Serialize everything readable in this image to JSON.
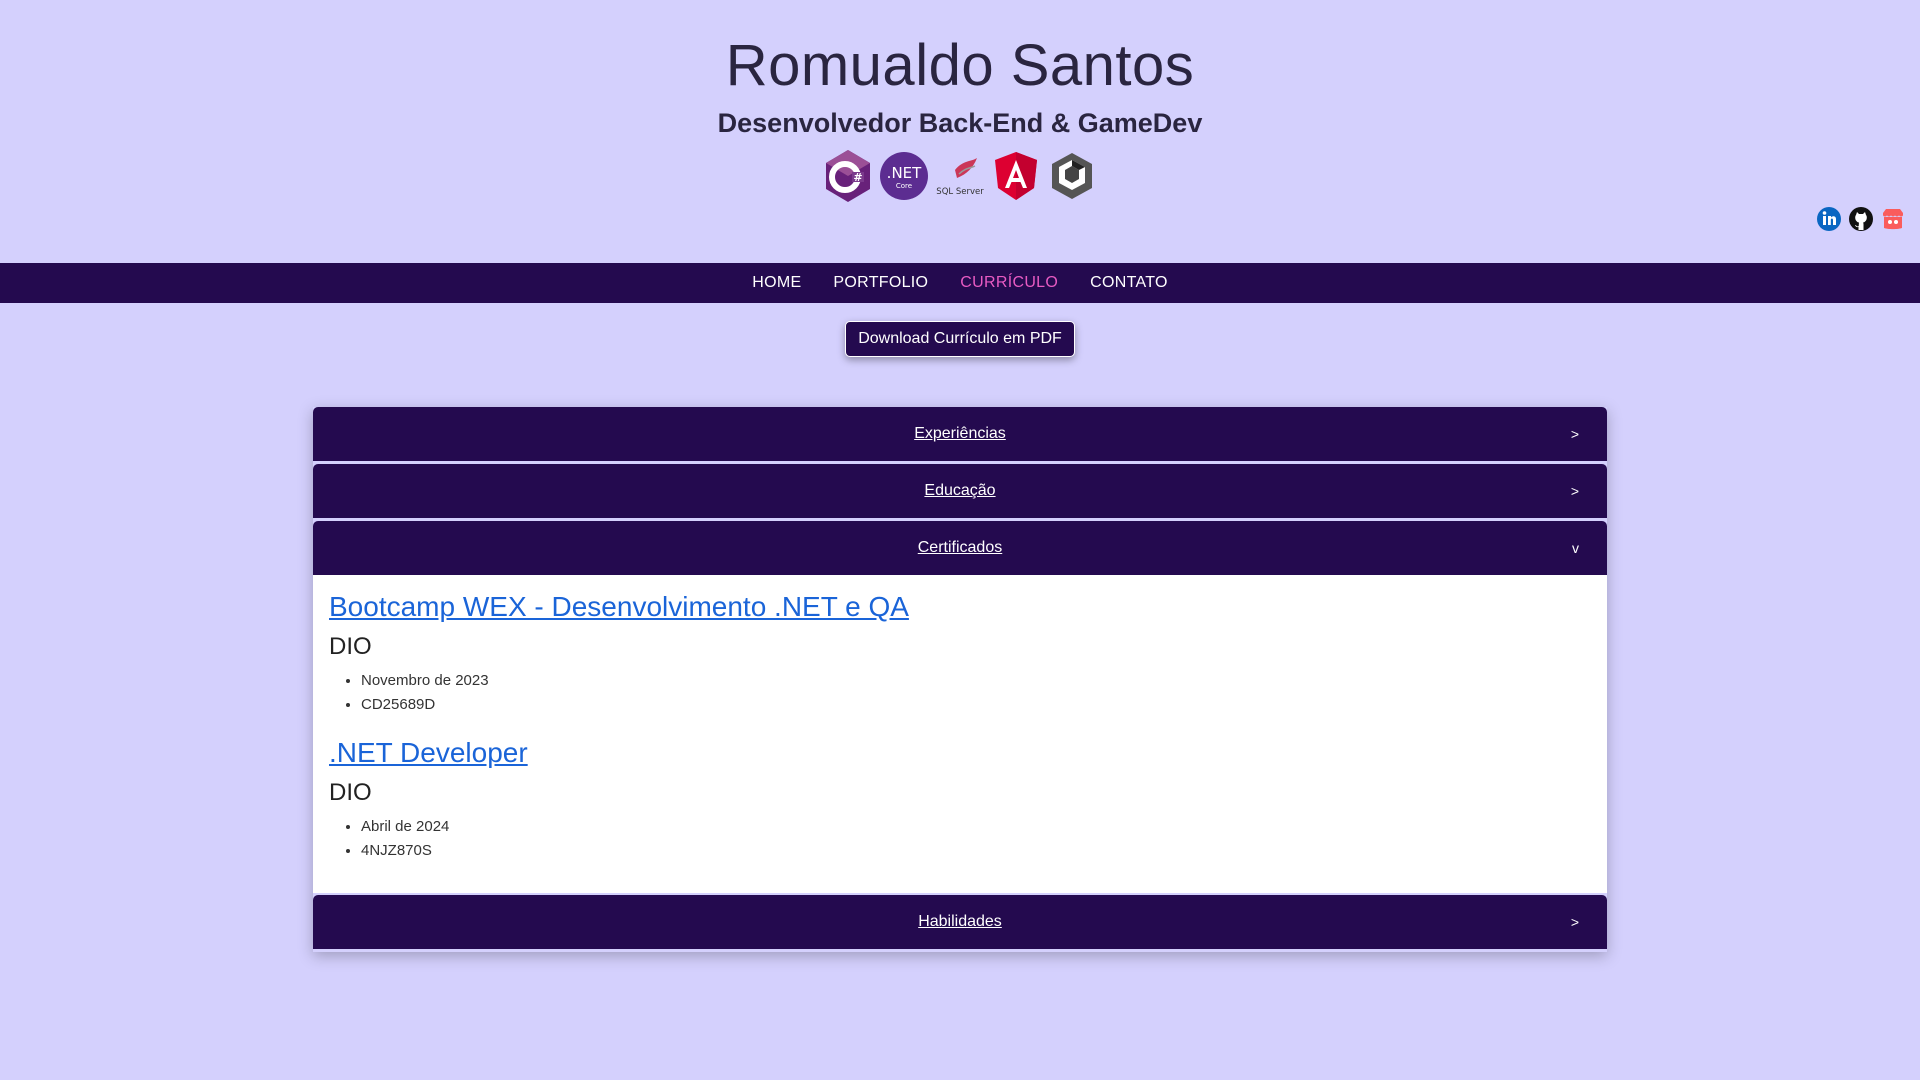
{
  "header": {
    "name": "Romualdo Santos",
    "subtitle": "Desenvolvedor Back-End & GameDev",
    "tech_icons": [
      "csharp-icon",
      "dotnet-core-icon",
      "sql-server-icon",
      "angular-icon",
      "unity-icon"
    ],
    "tech_labels": {
      "dotnet_main": ".NET",
      "dotnet_sub": "Core",
      "sqlserver": "SQL Server"
    },
    "social_icons": [
      "linkedin-icon",
      "github-icon",
      "itchio-icon"
    ]
  },
  "nav": {
    "items": [
      "HOME",
      "PORTFOLIO",
      "CURRÍCULO",
      "CONTATO"
    ],
    "active": "CURRÍCULO"
  },
  "download_button": "Download Currículo em PDF",
  "accordion": {
    "sections": [
      {
        "title": "Experiências",
        "arrow": ">"
      },
      {
        "title": "Educação",
        "arrow": ">"
      },
      {
        "title": "Certificados",
        "arrow": "v"
      },
      {
        "title": "Habilidades",
        "arrow": ">"
      }
    ],
    "certificates": [
      {
        "title": "Bootcamp WEX - Desenvolvimento .NET e QA",
        "org": "DIO",
        "details": [
          "Novembro de 2023",
          "CD25689D"
        ]
      },
      {
        "title": ".NET Developer",
        "org": "DIO",
        "details": [
          "Abril de 2024",
          "4NJZ870S"
        ]
      }
    ]
  },
  "colors": {
    "background": "#d4d0fd",
    "nav": "#240a4f",
    "active_link": "#e85bc3",
    "link": "#1a64d8"
  }
}
